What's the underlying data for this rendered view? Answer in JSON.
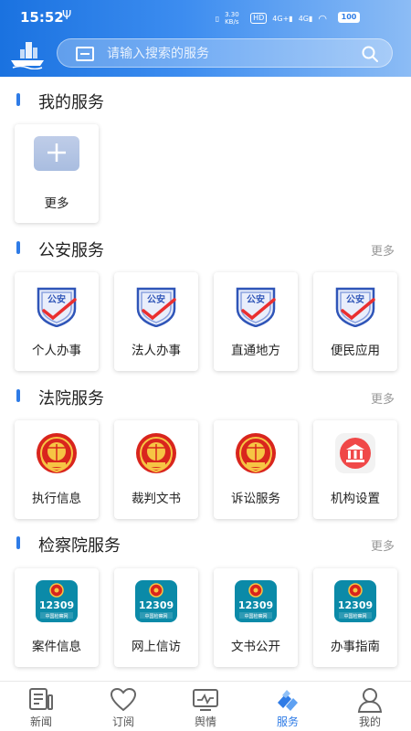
{
  "status": {
    "time": "15:52",
    "net_speed": "3.30 KB/s",
    "battery": "100"
  },
  "search": {
    "placeholder": "请输入搜索的服务"
  },
  "my_services": {
    "title": "我的服务",
    "items": [
      {
        "label": "更多",
        "icon": "plus-icon"
      }
    ]
  },
  "police": {
    "title": "公安服务",
    "more": "更多",
    "badge_text": "公安",
    "items": [
      {
        "label": "个人办事",
        "icon": "police-badge-icon"
      },
      {
        "label": "法人办事",
        "icon": "police-badge-icon"
      },
      {
        "label": "直通地方",
        "icon": "police-badge-icon"
      },
      {
        "label": "便民应用",
        "icon": "police-badge-icon"
      }
    ]
  },
  "court": {
    "title": "法院服务",
    "more": "更多",
    "items": [
      {
        "label": "执行信息",
        "icon": "court-emblem-icon"
      },
      {
        "label": "裁判文书",
        "icon": "court-emblem-icon"
      },
      {
        "label": "诉讼服务",
        "icon": "court-emblem-icon"
      },
      {
        "label": "机构设置",
        "icon": "institution-icon"
      }
    ]
  },
  "procuratorate": {
    "title": "检察院服务",
    "more": "更多",
    "badge_number": "12309",
    "badge_caption": "中国检察网",
    "items": [
      {
        "label": "案件信息",
        "icon": "procuratorate-12309-icon"
      },
      {
        "label": "网上信访",
        "icon": "procuratorate-12309-icon"
      },
      {
        "label": "文书公开",
        "icon": "procuratorate-12309-icon"
      },
      {
        "label": "办事指南",
        "icon": "procuratorate-12309-icon"
      }
    ]
  },
  "tabbar": {
    "active": "服务",
    "tabs": [
      {
        "label": "新闻",
        "icon": "news-icon"
      },
      {
        "label": "订阅",
        "icon": "heart-icon"
      },
      {
        "label": "舆情",
        "icon": "monitor-icon"
      },
      {
        "label": "服务",
        "icon": "service-icon"
      },
      {
        "label": "我的",
        "icon": "user-icon"
      }
    ]
  },
  "colors": {
    "accent": "#2e7be6",
    "header_start": "#1a72e0",
    "header_end": "#8cbcf5",
    "court_red": "#d9251d",
    "procuratorate_teal": "#0b8aa8"
  }
}
